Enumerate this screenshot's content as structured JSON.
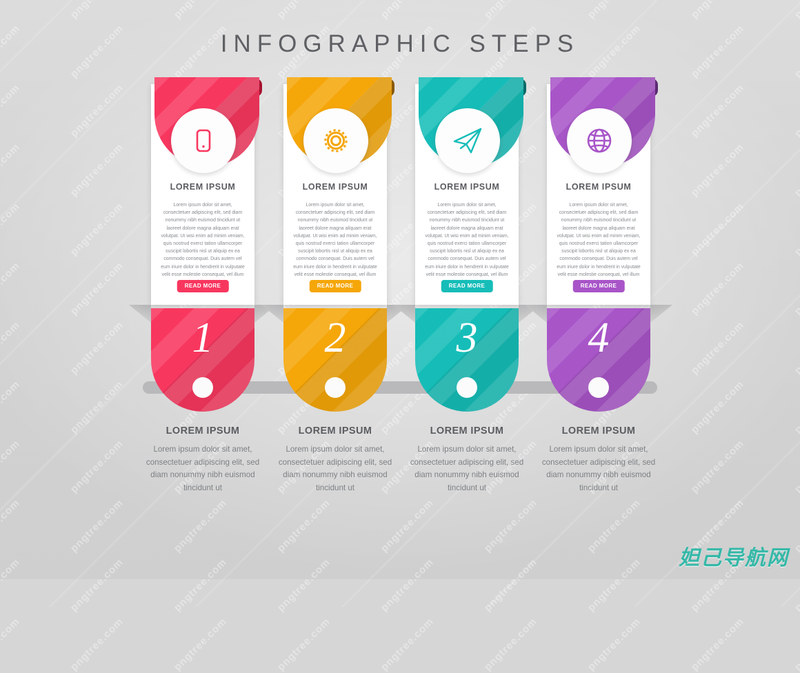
{
  "page": {
    "title": "INFOGRAPHIC STEPS",
    "background_color": "#d6d6d6",
    "title_color": "#5e6064",
    "rail_color": "#b9b9bb",
    "watermark": "妲己导航网",
    "watermark_color": "#35b8a8",
    "bg_watermark_text": "pngtree.com"
  },
  "steps": [
    {
      "number": "1",
      "color": "#F8375F",
      "color_dark": "#A8112F",
      "icon": "smartphone-icon",
      "card_heading": "LOREM IPSUM",
      "card_body": "Lorem ipsum dolor sit amet, consectetuer adipiscing elit, sed diam nonummy nibh euismod tincidunt ut laoreet dolore magna aliquam erat volutpat. Ut wisi enim ad minim veniam, quis nostrud exerci tation ullamcorper suscipit lobortis nisl ut aliquip ex ea commodo consequat. Duis autem vel eum iriure dolor in hendrerit in vulputate velit esse molestie consequat, vel illum dolore",
      "button_label": "READ MORE",
      "foot_heading": "LOREM IPSUM",
      "foot_body": "Lorem ipsum dolor sit amet, consectetuer adipiscing elit, sed diam nonummy nibh euismod tincidunt ut"
    },
    {
      "number": "2",
      "color": "#F5A609",
      "color_dark": "#8A5A05",
      "icon": "gear-icon",
      "card_heading": "LOREM IPSUM",
      "card_body": "Lorem ipsum dolor sit amet, consectetuer adipiscing elit, sed diam nonummy nibh euismod tincidunt ut laoreet dolore magna aliquam erat volutpat. Ut wisi enim ad minim veniam, quis nostrud exerci tation ullamcorper suscipit lobortis nisl ut aliquip ex ea commodo consequat. Duis autem vel eum iriure dolor in hendrerit in vulputate velit esse molestie consequat, vel illum dolore",
      "button_label": "READ MORE",
      "foot_heading": "LOREM IPSUM",
      "foot_body": "Lorem ipsum dolor sit amet, consectetuer adipiscing elit, sed diam nonummy nibh euismod tincidunt ut"
    },
    {
      "number": "3",
      "color": "#16BDB8",
      "color_dark": "#0B6B68",
      "icon": "paper-plane-icon",
      "card_heading": "LOREM IPSUM",
      "card_body": "Lorem ipsum dolor sit amet, consectetuer adipiscing elit, sed diam nonummy nibh euismod tincidunt ut laoreet dolore magna aliquam erat volutpat. Ut wisi enim ad minim veniam, quis nostrud exerci tation ullamcorper suscipit lobortis nisl ut aliquip ex ea commodo consequat. Duis autem vel eum iriure dolor in hendrerit in vulputate velit esse molestie consequat, vel illum dolore",
      "button_label": "READ MORE",
      "foot_heading": "LOREM IPSUM",
      "foot_body": "Lorem ipsum dolor sit amet, consectetuer adipiscing elit, sed diam nonummy nibh euismod tincidunt ut"
    },
    {
      "number": "4",
      "color": "#A855C8",
      "color_dark": "#5C2A73",
      "icon": "globe-icon",
      "card_heading": "LOREM IPSUM",
      "card_body": "Lorem ipsum dolor sit amet, consectetuer adipiscing elit, sed diam nonummy nibh euismod tincidunt ut laoreet dolore magna aliquam erat volutpat. Ut wisi enim ad minim veniam, quis nostrud exerci tation ullamcorper suscipit lobortis nisl ut aliquip ex ea commodo consequat. Duis autem vel eum iriure dolor in hendrerit in vulputate velit esse molestie consequat, vel illum dolore",
      "button_label": "READ MORE",
      "foot_heading": "LOREM IPSUM",
      "foot_body": "Lorem ipsum dolor sit amet, consectetuer adipiscing elit, sed diam nonummy nibh euismod tincidunt ut"
    }
  ]
}
